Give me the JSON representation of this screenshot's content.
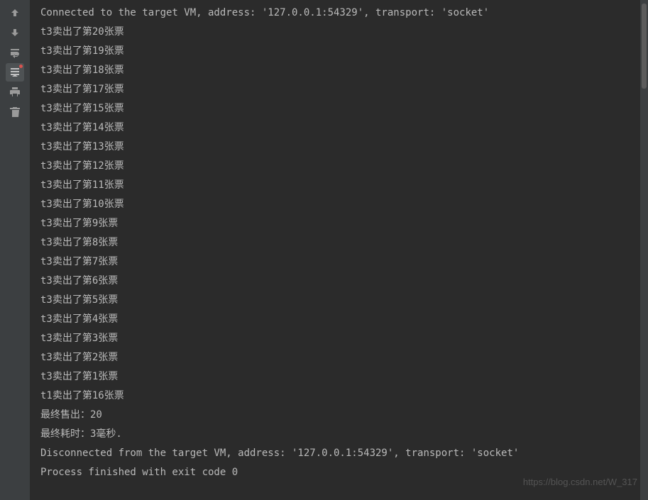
{
  "sidebar": {
    "icons": [
      {
        "name": "arrow-up-icon",
        "active": false
      },
      {
        "name": "arrow-down-icon",
        "active": false
      },
      {
        "name": "soft-wrap-icon",
        "active": false
      },
      {
        "name": "scroll-to-end-icon",
        "active": true,
        "red": true
      },
      {
        "name": "print-icon",
        "active": false
      },
      {
        "name": "trash-icon",
        "active": false
      }
    ]
  },
  "console": {
    "lines": [
      "Connected to the target VM, address: '127.0.0.1:54329', transport: 'socket'",
      "t3卖出了第20张票",
      "t3卖出了第19张票",
      "t3卖出了第18张票",
      "t3卖出了第17张票",
      "t3卖出了第15张票",
      "t3卖出了第14张票",
      "t3卖出了第13张票",
      "t3卖出了第12张票",
      "t3卖出了第11张票",
      "t3卖出了第10张票",
      "t3卖出了第9张票",
      "t3卖出了第8张票",
      "t3卖出了第7张票",
      "t3卖出了第6张票",
      "t3卖出了第5张票",
      "t3卖出了第4张票",
      "t3卖出了第3张票",
      "t3卖出了第2张票",
      "t3卖出了第1张票",
      "t1卖出了第16张票",
      "最终售出：20",
      "最终耗时：3毫秒.",
      "Disconnected from the target VM, address: '127.0.0.1:54329', transport: 'socket'",
      "",
      "Process finished with exit code 0"
    ]
  },
  "watermark": "https://blog.csdn.net/W_317"
}
